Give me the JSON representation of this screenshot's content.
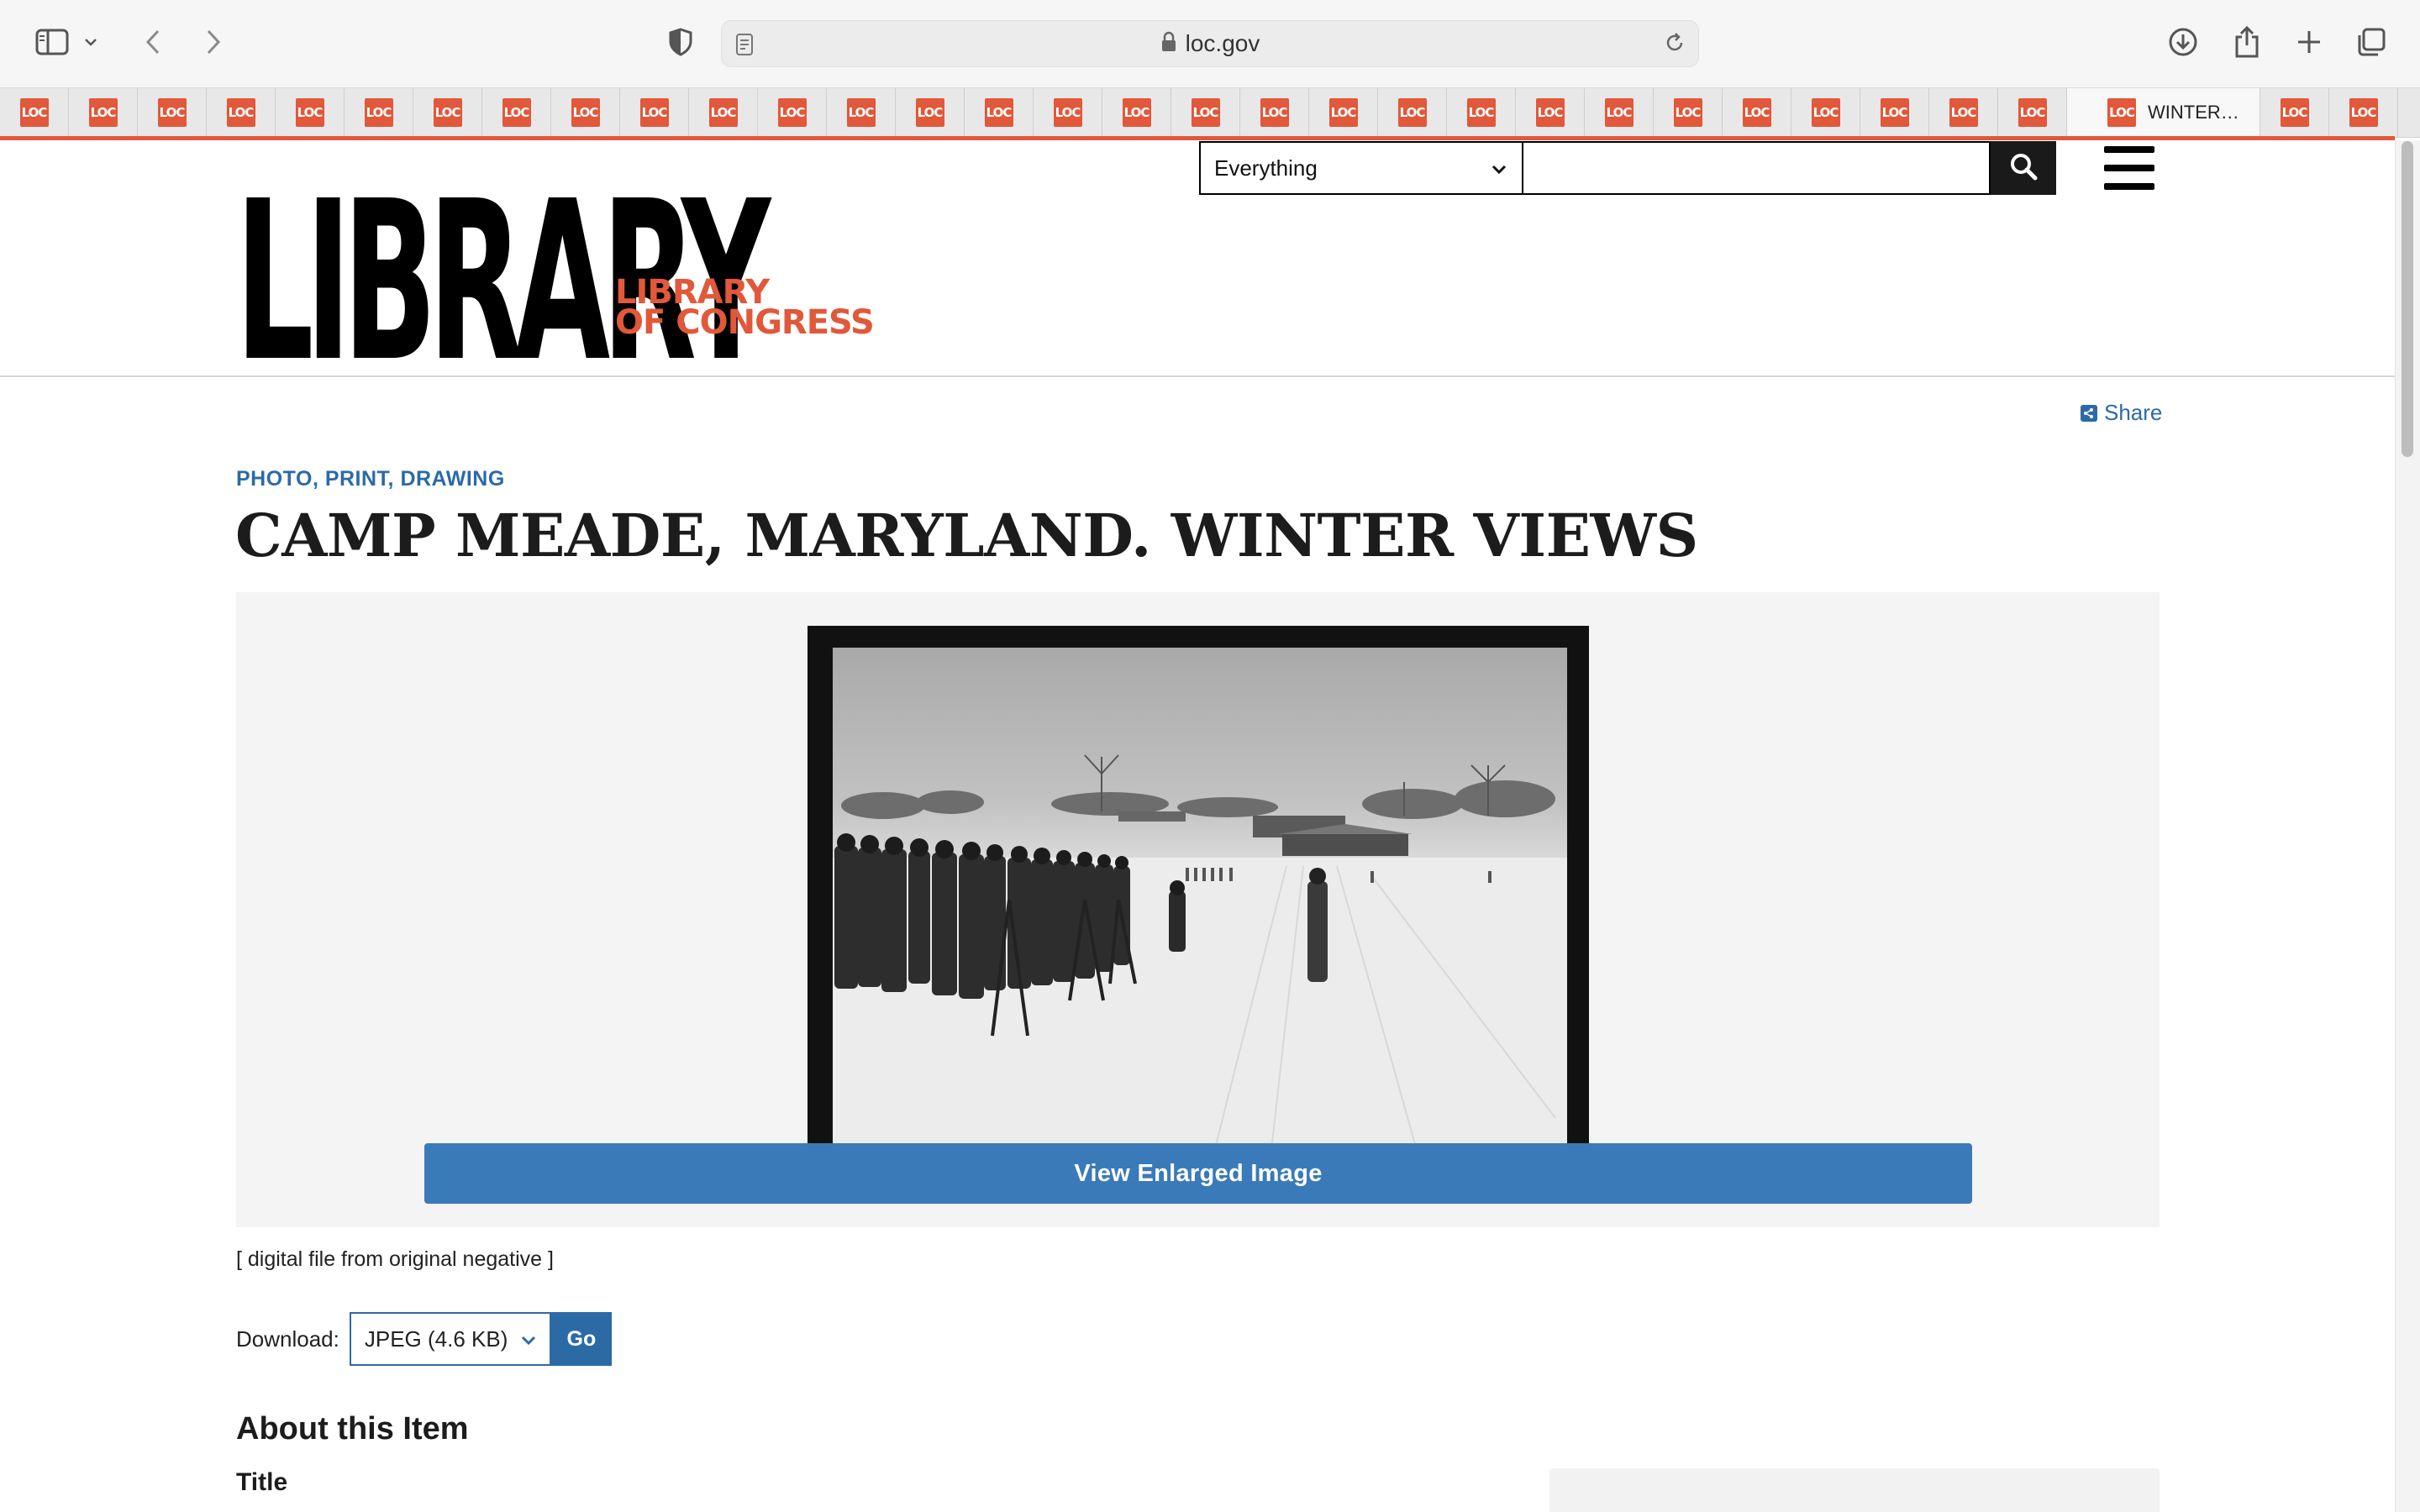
{
  "browser": {
    "url": "loc.gov",
    "active_tab_title": "WINTER…",
    "favicon_text": "LOC"
  },
  "header": {
    "logo_big": "LIBRARY",
    "logo_small_line1": "LIBRARY",
    "logo_small_line2": "OF CONGRESS",
    "search_scope": "Everything",
    "search_placeholder": ""
  },
  "page": {
    "share_label": "Share",
    "category": "PHOTO, PRINT, DRAWING",
    "title": "CAMP MEADE, MARYLAND. WINTER VIEWS",
    "view_button": "View Enlarged Image",
    "caption": "[ digital file from original negative ]",
    "download_label": "Download:",
    "download_option": "JPEG (4.6 KB)",
    "go_button": "Go",
    "about_heading": "About this Item",
    "field_title": "Title"
  },
  "colors": {
    "brand_orange": "#e1583a",
    "link_blue": "#2c6aa6",
    "button_blue": "#3a7ab8"
  },
  "icons": [
    "sidebar-icon",
    "chevron-down-icon",
    "back-icon",
    "forward-icon",
    "shield-icon",
    "reader-icon",
    "lock-icon",
    "reload-icon",
    "download-icon",
    "share-icon",
    "plus-icon",
    "tabs-overview-icon",
    "search-icon",
    "hamburger-icon"
  ]
}
